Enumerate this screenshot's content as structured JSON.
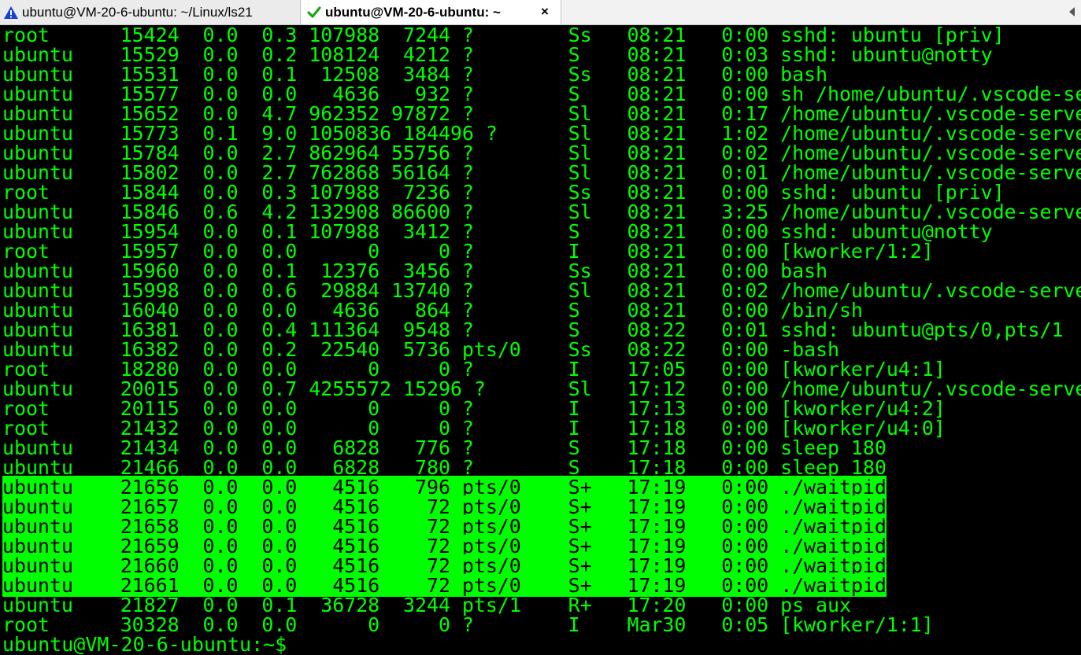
{
  "tabs": [
    {
      "title": "ubuntu@VM-20-6-ubuntu: ~/Linux/ls21",
      "status": "warning-icon",
      "active": false
    },
    {
      "title": "ubuntu@VM-20-6-ubuntu: ~",
      "status": "check-icon",
      "active": true,
      "close": "×"
    }
  ],
  "colors": {
    "fg": "#00ff00",
    "bg": "#000000",
    "highlight_bg": "#00ff00",
    "highlight_fg": "#000000"
  },
  "terminal": {
    "lines": [
      {
        "text": "root      15424  0.0  0.3 107988  7244 ?        Ss   08:21   0:00 sshd: ubuntu [priv]",
        "highlight": false
      },
      {
        "text": "ubuntu    15529  0.0  0.2 108124  4212 ?        S    08:21   0:03 sshd: ubuntu@notty",
        "highlight": false
      },
      {
        "text": "ubuntu    15531  0.0  0.1  12508  3484 ?        Ss   08:21   0:00 bash",
        "highlight": false
      },
      {
        "text": "ubuntu    15577  0.0  0.0   4636   932 ?        S    08:21   0:00 sh /home/ubuntu/.vscode-se",
        "highlight": false
      },
      {
        "text": "ubuntu    15652  0.0  4.7 962352 97872 ?        Sl   08:21   0:17 /home/ubuntu/.vscode-serve",
        "highlight": false
      },
      {
        "text": "ubuntu    15773  0.1  9.0 1050836 184496 ?      Sl   08:21   1:02 /home/ubuntu/.vscode-serve",
        "highlight": false
      },
      {
        "text": "ubuntu    15784  0.0  2.7 862964 55756 ?        Sl   08:21   0:02 /home/ubuntu/.vscode-serve",
        "highlight": false
      },
      {
        "text": "ubuntu    15802  0.0  2.7 762868 56164 ?        Sl   08:21   0:01 /home/ubuntu/.vscode-serve",
        "highlight": false
      },
      {
        "text": "root      15844  0.0  0.3 107988  7236 ?        Ss   08:21   0:00 sshd: ubuntu [priv]",
        "highlight": false
      },
      {
        "text": "ubuntu    15846  0.6  4.2 132908 86600 ?        Sl   08:21   3:25 /home/ubuntu/.vscode-serve",
        "highlight": false
      },
      {
        "text": "ubuntu    15954  0.0  0.1 107988  3412 ?        S    08:21   0:00 sshd: ubuntu@notty",
        "highlight": false
      },
      {
        "text": "root      15957  0.0  0.0      0     0 ?        I    08:21   0:00 [kworker/1:2]",
        "highlight": false
      },
      {
        "text": "ubuntu    15960  0.0  0.1  12376  3456 ?        Ss   08:21   0:00 bash",
        "highlight": false
      },
      {
        "text": "ubuntu    15998  0.0  0.6  29884 13740 ?        Sl   08:21   0:02 /home/ubuntu/.vscode-serve",
        "highlight": false
      },
      {
        "text": "ubuntu    16040  0.0  0.0   4636   864 ?        S    08:21   0:00 /bin/sh",
        "highlight": false
      },
      {
        "text": "ubuntu    16381  0.0  0.4 111364  9548 ?        S    08:22   0:01 sshd: ubuntu@pts/0,pts/1",
        "highlight": false
      },
      {
        "text": "ubuntu    16382  0.0  0.2  22540  5736 pts/0    Ss   08:22   0:00 -bash",
        "highlight": false
      },
      {
        "text": "root      18280  0.0  0.0      0     0 ?        I    17:05   0:00 [kworker/u4:1]",
        "highlight": false
      },
      {
        "text": "ubuntu    20015  0.0  0.7 4255572 15296 ?       Sl   17:12   0:00 /home/ubuntu/.vscode-serve",
        "highlight": false
      },
      {
        "text": "root      20115  0.0  0.0      0     0 ?        I    17:13   0:00 [kworker/u4:2]",
        "highlight": false
      },
      {
        "text": "root      21432  0.0  0.0      0     0 ?        I    17:18   0:00 [kworker/u4:0]",
        "highlight": false
      },
      {
        "text": "ubuntu    21434  0.0  0.0   6828   776 ?        S    17:18   0:00 sleep 180",
        "highlight": false
      },
      {
        "text": "ubuntu    21466  0.0  0.0   6828   780 ?        S    17:18   0:00 sleep 180",
        "highlight": false
      },
      {
        "text": "ubuntu    21656  0.0  0.0   4516   796 pts/0    S+   17:19   0:00 ./waitpid",
        "highlight": true
      },
      {
        "text": "ubuntu    21657  0.0  0.0   4516    72 pts/0    S+   17:19   0:00 ./waitpid",
        "highlight": true
      },
      {
        "text": "ubuntu    21658  0.0  0.0   4516    72 pts/0    S+   17:19   0:00 ./waitpid",
        "highlight": true
      },
      {
        "text": "ubuntu    21659  0.0  0.0   4516    72 pts/0    S+   17:19   0:00 ./waitpid",
        "highlight": true
      },
      {
        "text": "ubuntu    21660  0.0  0.0   4516    72 pts/0    S+   17:19   0:00 ./waitpid",
        "highlight": true
      },
      {
        "text": "ubuntu    21661  0.0  0.0   4516    72 pts/0    S+   17:19   0:00 ./waitpid",
        "highlight": true
      },
      {
        "text": "ubuntu    21827  0.0  0.1  36728  3244 pts/1    R+   17:20   0:00 ps aux",
        "highlight": false
      },
      {
        "text": "root      30328  0.0  0.0      0     0 ?        I    Mar30   0:05 [kworker/1:1]",
        "highlight": false
      }
    ],
    "prompt": "ubuntu@VM-20-6-ubuntu:~$"
  }
}
